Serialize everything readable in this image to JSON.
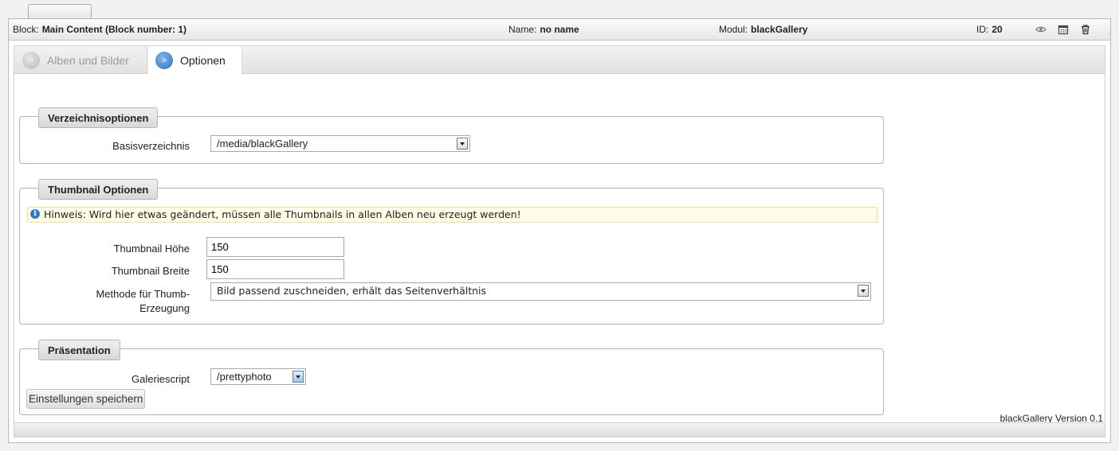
{
  "header": {
    "block_label": "Block:",
    "block_value": "Main Content (Block number: 1)",
    "name_label": "Name:",
    "name_value": "no name",
    "modul_label": "Modul:",
    "modul_value": "blackGallery",
    "id_label": "ID:",
    "id_value": "20",
    "icons": [
      "eye-icon",
      "calendar-icon",
      "trash-icon"
    ]
  },
  "tabs": [
    {
      "label": "Alben und Bilder",
      "active": false
    },
    {
      "label": "Optionen",
      "active": true
    }
  ],
  "sections": {
    "verzeichnis": {
      "legend": "Verzeichnisoptionen",
      "basis_label": "Basisverzeichnis",
      "basis_value": "/media/blackGallery"
    },
    "thumbnail": {
      "legend": "Thumbnail Optionen",
      "notice": "Hinweis: Wird hier etwas geändert, müssen alle Thumbnails in allen Alben neu erzeugt werden!",
      "hoehe_label": "Thumbnail Höhe",
      "hoehe_value": "150",
      "breite_label": "Thumbnail Breite",
      "breite_value": "150",
      "methode_label_line1": "Methode für Thumb-",
      "methode_label_line2": "Erzeugung",
      "methode_value": "Bild passend zuschneiden, erhält das Seitenverhältnis"
    },
    "praesentation": {
      "legend": "Präsentation",
      "galerie_label": "Galeriescript",
      "galerie_value": "/prettyphoto",
      "save_label": "Einstellungen speichern"
    }
  },
  "footer": {
    "version": "blackGallery Version 0.1"
  },
  "colors": {
    "active_tab_icon": "#2b73bf",
    "notice_bg": "#fffbe6",
    "info_icon": "#2f79c9"
  }
}
